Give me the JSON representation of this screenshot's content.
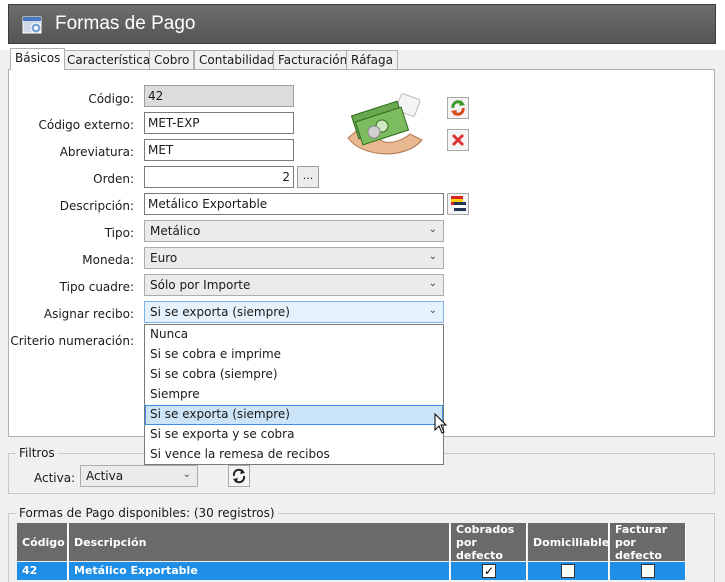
{
  "window": {
    "title": "Formas de Pago"
  },
  "tabs": [
    "Básicos",
    "Características",
    "Cobro",
    "Contabilidad",
    "Facturación",
    "Ráfaga"
  ],
  "form": {
    "codigo_label": "Código:",
    "codigo_value": "42",
    "codigo_externo_label": "Código externo:",
    "codigo_externo_value": "MET-EXP",
    "abreviatura_label": "Abreviatura:",
    "abreviatura_value": "MET",
    "orden_label": "Orden:",
    "orden_value": "2",
    "orden_button": "...",
    "descripcion_label": "Descripción:",
    "descripcion_value": "Metálico Exportable",
    "tipo_label": "Tipo:",
    "tipo_value": "Metálico",
    "moneda_label": "Moneda:",
    "moneda_value": "Euro",
    "tipo_cuadre_label": "Tipo cuadre:",
    "tipo_cuadre_value": "Sólo por Importe",
    "asignar_recibo_label": "Asignar recibo:",
    "asignar_recibo_value": "Si se exporta (siempre)",
    "criterio_label": "Criterio numeración:"
  },
  "dropdown": {
    "options": [
      "Nunca",
      "Si se cobra e imprime",
      "Si se cobra (siempre)",
      "Siempre",
      "Si se exporta (siempre)",
      "Si se exporta y se cobra",
      "Si vence la remesa de recibos"
    ],
    "selected": "Si se exporta (siempre)"
  },
  "filtros": {
    "title": "Filtros",
    "activa_label": "Activa:",
    "activa_value": "Activa"
  },
  "disponibles": {
    "title": "Formas de Pago disponibles:",
    "count": "(30 registros)",
    "columns": [
      "Código",
      "Descripción",
      "Cobrados por defecto",
      "Domiciliable",
      "Facturar por defecto"
    ],
    "rows": [
      {
        "codigo": "42",
        "descripcion": "Metálico Exportable",
        "cobrados": true,
        "domiciliable": false,
        "facturar": false
      }
    ]
  },
  "colors": {
    "titlebar": "#5f5f5f",
    "grid_header": "#6a6a6a",
    "selected_row": "#1e8ee6",
    "dropdown_highlight": "#cce4f7"
  }
}
